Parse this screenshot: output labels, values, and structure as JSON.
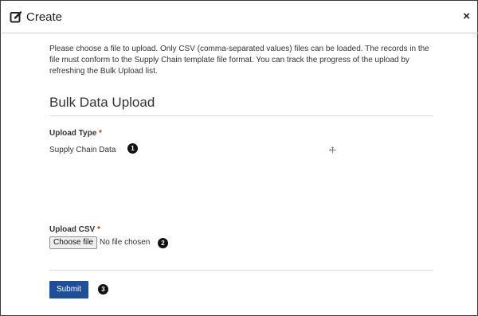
{
  "dialog": {
    "title": "Create",
    "close_symbol": "×"
  },
  "description": "Please choose a file to upload. Only CSV (comma-separated values) files can be loaded. The records in the file must conform to the Supply Chain template file format. You can track the progress of the upload by refreshing the Bulk Upload list.",
  "section_title": "Bulk Data Upload",
  "upload_type": {
    "label": "Upload Type",
    "required_marker": "*",
    "value": "Supply Chain Data"
  },
  "upload_csv": {
    "label": "Upload CSV",
    "required_marker": "*",
    "button_label": "Choose file",
    "status": "No file chosen"
  },
  "submit_label": "Submit",
  "callouts": [
    "1",
    "2",
    "3"
  ],
  "icons": {
    "header": "edit-icon",
    "cursor": "move-cursor-icon"
  },
  "colors": {
    "submit_bg": "#1f4e9a",
    "required": "#c0392b"
  }
}
